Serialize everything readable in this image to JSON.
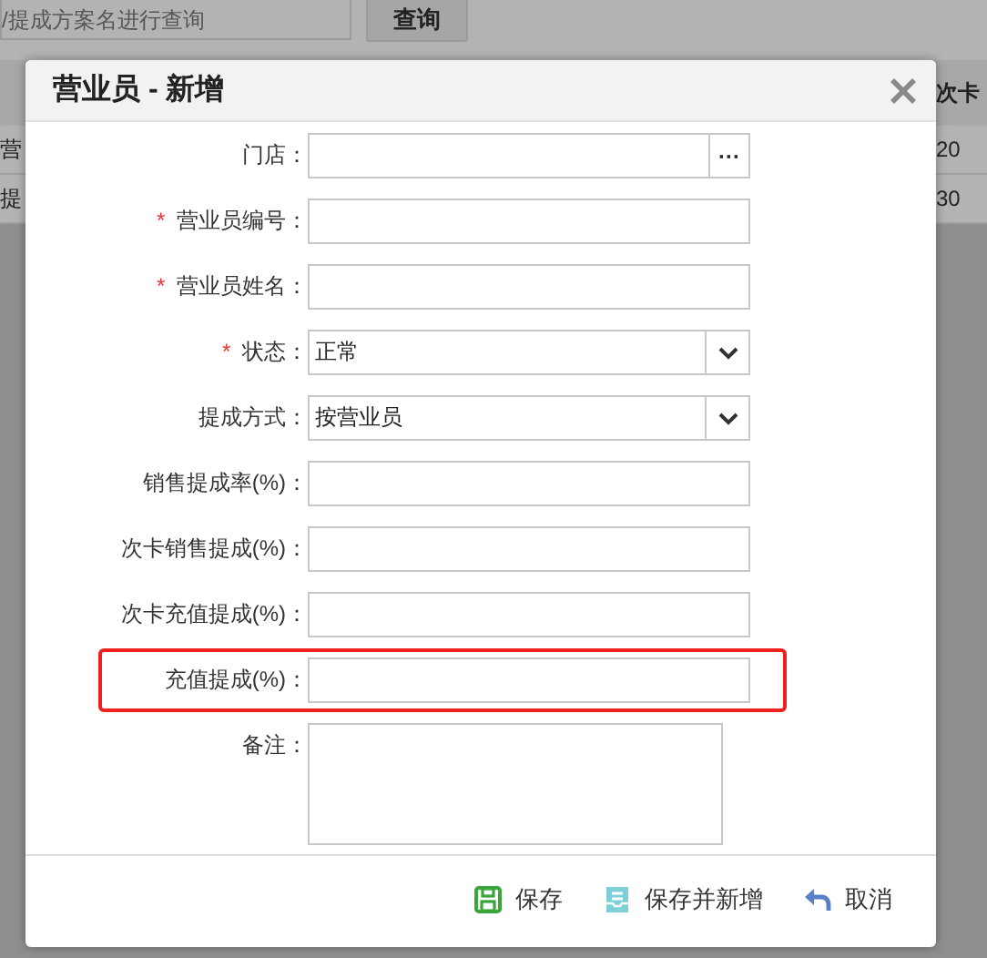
{
  "background": {
    "search": {
      "placeholder": "/提成方案名进行查询"
    },
    "search_button": "查询",
    "table": {
      "header_right": "次卡",
      "rows": [
        {
          "column_1": "营",
          "column_2": "20"
        },
        {
          "column_1": "提",
          "column_2": "30"
        }
      ]
    }
  },
  "dialog": {
    "title": "营业员 - 新增",
    "fields": [
      {
        "kind": "picker",
        "label": "门店：",
        "button": "···",
        "highlighted": false
      },
      {
        "kind": "text",
        "label": "营业员编号：",
        "required_mark": "*",
        "highlighted": false
      },
      {
        "kind": "text",
        "label": "营业员姓名：",
        "required_mark": "*",
        "highlighted": false
      },
      {
        "kind": "select",
        "label": "状态：",
        "required_mark": "*",
        "value": "正常",
        "highlighted": false
      },
      {
        "kind": "select",
        "label": "提成方式：",
        "value": "按营业员",
        "highlighted": false
      },
      {
        "kind": "text",
        "label": "销售提成率(%)：",
        "highlighted": false
      },
      {
        "kind": "text",
        "label": "次卡销售提成(%)：",
        "highlighted": false
      },
      {
        "kind": "text",
        "label": "次卡充值提成(%)：",
        "highlighted": false
      },
      {
        "kind": "text",
        "label": "充值提成(%)：",
        "highlighted": true
      },
      {
        "kind": "textarea",
        "label": "备注：",
        "highlighted": false
      }
    ],
    "buttons": [
      {
        "kind": "save",
        "label": "保存"
      },
      {
        "kind": "save_new",
        "label": "保存并新增"
      },
      {
        "kind": "cancel",
        "label": "取消"
      }
    ]
  }
}
